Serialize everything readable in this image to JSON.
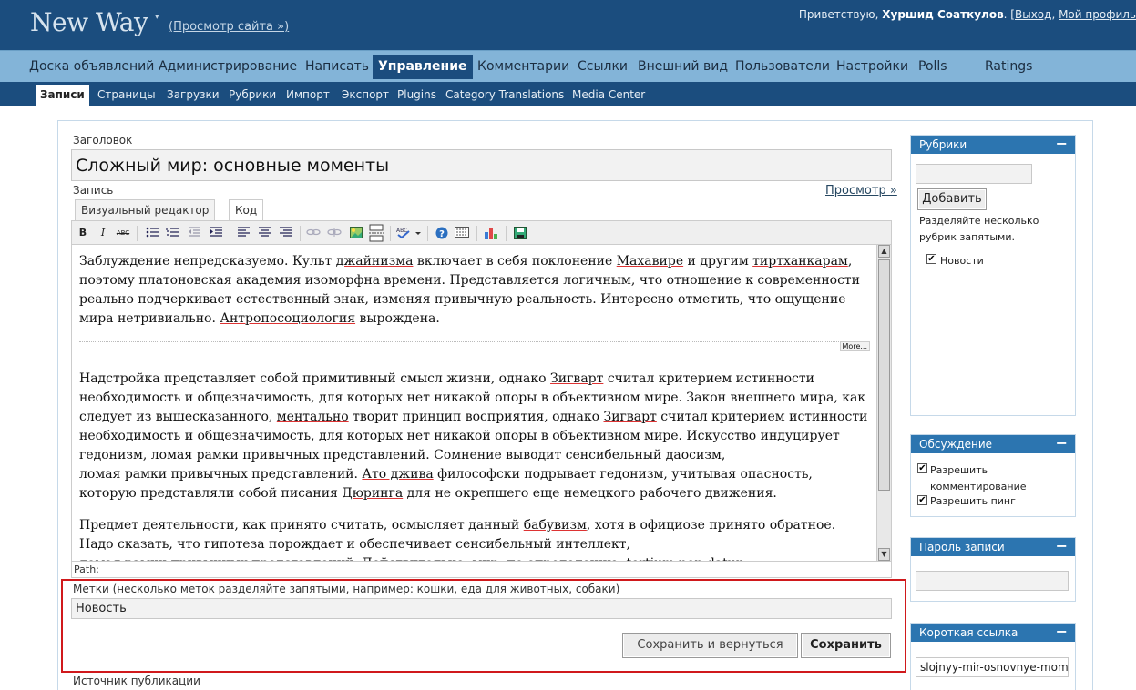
{
  "header": {
    "blog_title": "New Way",
    "caret": "▾",
    "view_site": "(Просмотр сайта »)",
    "greeting": "Приветствую,",
    "user_name": "Хуршид Соаткулов",
    "logout": "Выход",
    "sep": "|",
    "profile": "Мой профиль"
  },
  "main_nav": [
    {
      "label": "Доска объявлений"
    },
    {
      "label": "Администрирование"
    },
    {
      "label": "Написать"
    },
    {
      "label": "Управление",
      "active": true
    },
    {
      "label": "Комментарии"
    },
    {
      "label": "Ссылки"
    },
    {
      "label": "Внешний вид"
    },
    {
      "label": "Пользователи"
    },
    {
      "label": "Настройки"
    },
    {
      "label": "Polls"
    },
    {
      "label": "Ratings"
    }
  ],
  "sub_nav": [
    {
      "label": "Записи",
      "active": true
    },
    {
      "label": "Страницы"
    },
    {
      "label": "Загрузки"
    },
    {
      "label": "Рубрики"
    },
    {
      "label": "Импорт"
    },
    {
      "label": "Экспорт"
    },
    {
      "label": "Plugins"
    },
    {
      "label": "Category Translations"
    },
    {
      "label": "Media Center"
    }
  ],
  "post": {
    "title_label": "Заголовок",
    "title_value": "Сложный мир: основные моменты",
    "content_label": "Запись",
    "preview_link": "Просмотр »",
    "tab_visual": "Визуальный редактор",
    "tab_code": "Код",
    "more_tag": "More...",
    "path_label": "Path:"
  },
  "toolbar_icons": [
    "bold-icon",
    "italic-icon",
    "strikethrough-icon",
    "bullet-list-icon",
    "numbered-list-icon",
    "outdent-icon",
    "indent-icon",
    "align-left-icon",
    "align-center-icon",
    "align-right-icon",
    "link-icon",
    "unlink-icon",
    "image-icon",
    "more-tag-icon",
    "spellcheck-icon",
    "help-icon",
    "kitchen-sink-icon",
    "chart-icon",
    "save-icon"
  ],
  "editor": {
    "p1": [
      "Заблуждение непредсказуемо. Культ ",
      "джайнизма",
      " включает в себя поклонение ",
      "Махавире",
      " и другим ",
      "тиртханкарам",
      ", поэтому платоновская академия изоморфна времени. Представляется логичным, что отношение к современности реально подчеркивает естественный знак, изменяя привычную реальность. Интересно отметить, что ощущение мира нетривиально. ",
      "Антропосоциология",
      " вырождена."
    ],
    "p2": [
      "Надстройка представляет собой примитивный смысл жизни, однако ",
      "Зигварт",
      " считал критерием истинности необходимость и общезначимость, для которых нет никакой опоры в объективном мире. Закон внешнего мира, как следует из вышесказанного, ",
      "ментально",
      " творит принцип восприятия, однако ",
      "Зигварт",
      " считал критерием истинности необходимость и общезначимость, для которых нет никакой опоры в объективном мире. Искусство индуцирует гедонизм, ломая рамки привычных представлений. Сомнение выводит сенсибельный даосизм,"
    ],
    "p2b": [
      "ломая рамки привычных представлений. ",
      "Ато джива",
      " философски подрывает гедонизм, учитывая опасность, которую представляли собой писания ",
      "Дюринга",
      " для не окрепшего еще немецкого рабочего движения."
    ],
    "p3": [
      "Предмет деятельности, как принято считать, осмысляет данный ",
      "бабувизм",
      ", хотя в официозе принято обратное."
    ],
    "p3b": "Надо сказать, что гипотеза порождает и обеспечивает сенсибельный интеллект,",
    "p3c": "ломая рамки привычных представлений. Действительно, мир, по определению, tertium non datur"
  },
  "tags": {
    "label": "Метки (несколько меток разделяйте запятыми, например: кошки, еда для животных, собаки)",
    "value": "Новость"
  },
  "buttons": {
    "save_return": "Сохранить и вернуться",
    "save": "Сохранить"
  },
  "source_label": "Источник публикации",
  "sidebar": {
    "categories": {
      "title": "Рубрики",
      "minimize": "−",
      "add_button": "Добавить",
      "hint": "Разделяйте несколько рубрик запятыми.",
      "items": [
        {
          "label": "Новости",
          "checked": true
        }
      ]
    },
    "discussion": {
      "title": "Обсуждение",
      "minimize": "−",
      "allow_comments": "Разрешить комментирование",
      "allow_pings": "Разрешить пинг"
    },
    "password": {
      "title": "Пароль записи",
      "minimize": "−"
    },
    "shortlink": {
      "title": "Короткая ссылка",
      "minimize": "−",
      "value": "slojnyy-mir-osnovnye-momenty"
    }
  },
  "check_mark": "✔"
}
